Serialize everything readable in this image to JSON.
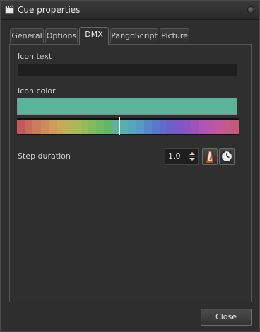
{
  "window": {
    "title": "Cue properties"
  },
  "tabs": [
    {
      "label": "General"
    },
    {
      "label": "Options"
    },
    {
      "label": "DMX"
    },
    {
      "label": "PangoScript"
    },
    {
      "label": "Picture"
    }
  ],
  "active_tab": "DMX",
  "fields": {
    "icon_text_label": "Icon text",
    "icon_text_value": "",
    "icon_color_label": "Icon color",
    "icon_color_value": "#5ab39a",
    "step_duration_label": "Step duration",
    "step_duration_value": "1.0"
  },
  "palette_colors": [
    "#c2595a",
    "#c96a5a",
    "#cc7c5a",
    "#cf8c5a",
    "#cf9a5a",
    "#c9a85a",
    "#b9b25a",
    "#a8b85a",
    "#96bb5a",
    "#82bb5c",
    "#6fba60",
    "#5eb866",
    "#5ab39a",
    "#57b0ae",
    "#55a7bb",
    "#5599c4",
    "#5688c8",
    "#5a78cb",
    "#6169cb",
    "#6c5fc9",
    "#7b58c6",
    "#8b55c2",
    "#9c54bc",
    "#ac55b4",
    "#b857aa",
    "#c0599c",
    "#c45a8a",
    "#c45a78"
  ],
  "icons": {
    "app": "clapperboard-icon",
    "metronome": "metronome-icon",
    "clock": "clock-icon"
  },
  "buttons": {
    "close": "Close"
  }
}
